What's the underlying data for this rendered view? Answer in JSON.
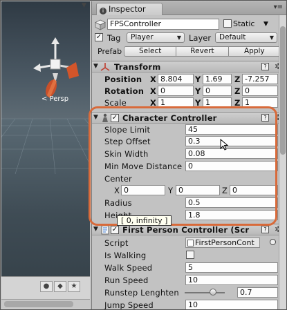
{
  "scene": {
    "persp_label": "< Persp"
  },
  "inspector": {
    "tab_label": "Inspector",
    "gameobject": {
      "name": "FPSController",
      "static_label": "Static",
      "tag_label": "Tag",
      "tag_value": "Player",
      "layer_label": "Layer",
      "layer_value": "Default",
      "prefab_label": "Prefab",
      "prefab_buttons": [
        "Select",
        "Revert",
        "Apply"
      ]
    },
    "transform": {
      "title": "Transform",
      "position_label": "Position",
      "position": {
        "x": "8.804",
        "y": "1.69",
        "z": "-7.257"
      },
      "rotation_label": "Rotation",
      "rotation": {
        "x": "0",
        "y": "0",
        "z": "0"
      },
      "scale_label": "Scale",
      "scale": {
        "x": "1",
        "y": "1",
        "z": "1"
      },
      "axis_labels": [
        "X",
        "Y",
        "Z"
      ]
    },
    "character_controller": {
      "title": "Character Controller",
      "slope_limit_label": "Slope Limit",
      "slope_limit": "45",
      "step_offset_label": "Step Offset",
      "step_offset": "0.3",
      "skin_width_label": "Skin Width",
      "skin_width": "0.08",
      "min_move_label": "Min Move Distance",
      "min_move": "0",
      "center_label": "Center",
      "center": {
        "x": "0",
        "y": "0",
        "z": "0"
      },
      "radius_label": "Radius",
      "radius": "0.5",
      "height_label": "Height",
      "height": "1.8",
      "tooltip": "[ 0, infinity ]"
    },
    "fps_controller": {
      "title": "First Person Controller (Scr",
      "script_label": "Script",
      "script_value": "FirstPersonCont",
      "is_walking_label": "Is Walking",
      "walk_speed_label": "Walk Speed",
      "walk_speed": "5",
      "run_speed_label": "Run Speed",
      "run_speed": "10",
      "runstep_label": "Runstep Lenghten",
      "runstep": "0.7",
      "runstep_fraction": 0.7,
      "jump_speed_label": "Jump Speed",
      "jump_speed": "10"
    }
  },
  "colors": {
    "highlight": "#d86a3a",
    "panel": "#c2c2c2"
  }
}
